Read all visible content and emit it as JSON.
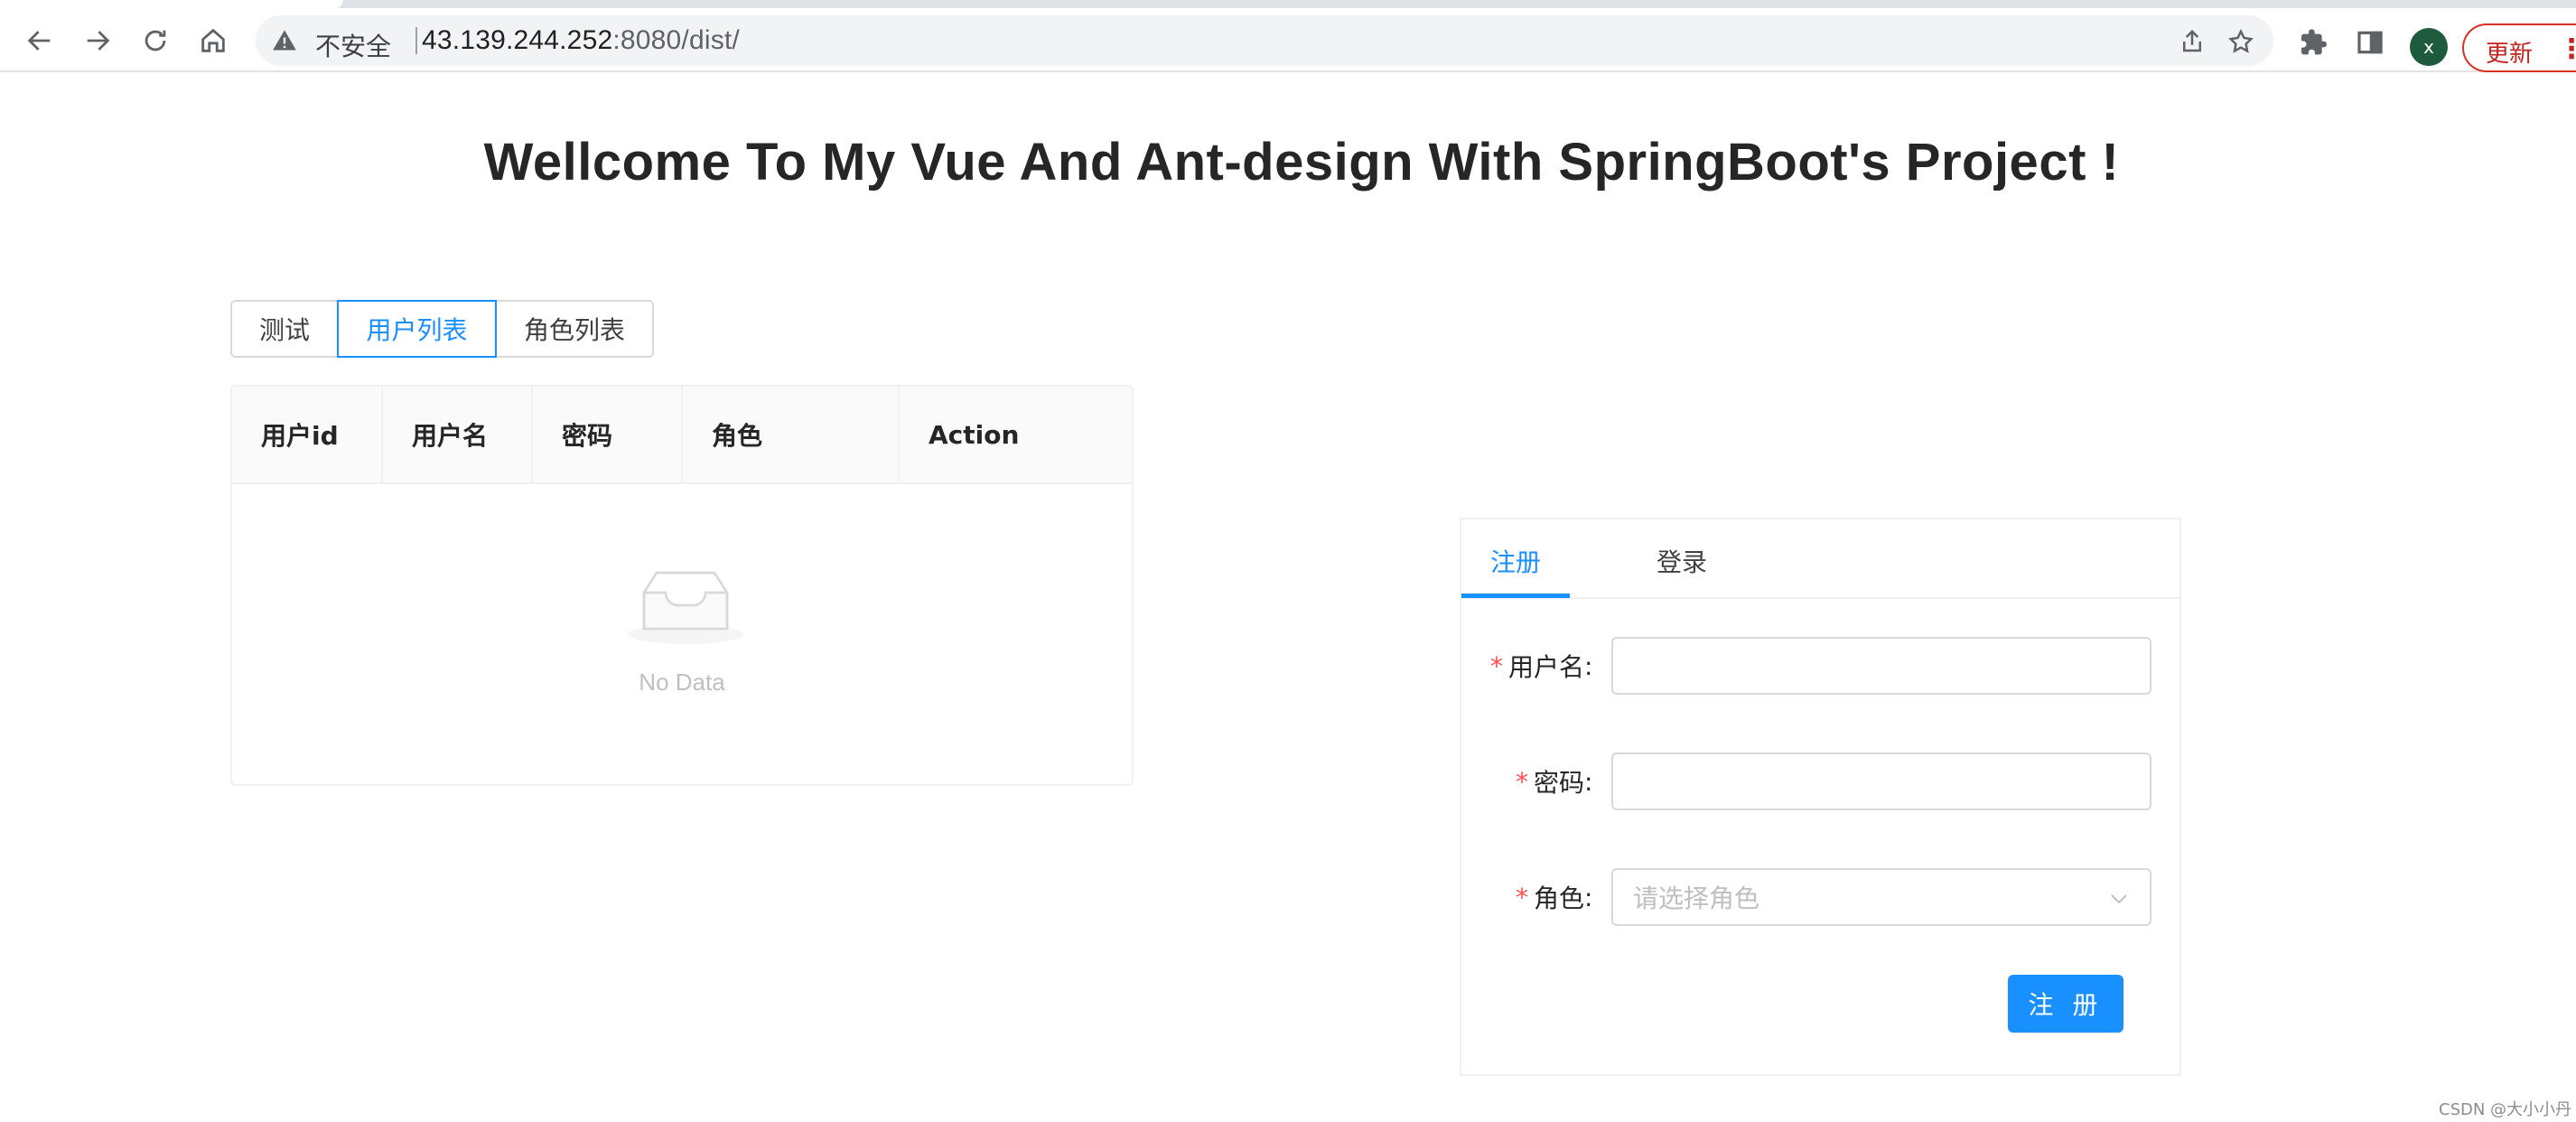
{
  "browser": {
    "security_label": "不安全",
    "url_host": "43.139.244.252",
    "url_path": ":8080/dist/",
    "profile_initial": "x",
    "update_label": "更新",
    "icons": [
      "back-icon",
      "forward-icon",
      "reload-icon",
      "home-icon",
      "warning-icon",
      "share-icon",
      "star-icon",
      "extensions-icon",
      "side-panel-icon",
      "menu-icon"
    ]
  },
  "page": {
    "title": "Wellcome To My Vue And Ant-design With SpringBoot's Project !"
  },
  "list_switch": {
    "options": [
      "测试",
      "用户列表",
      "角色列表"
    ],
    "selected": "用户列表"
  },
  "table": {
    "columns": [
      "用户id",
      "用户名",
      "密码",
      "角色",
      "Action"
    ],
    "rows": [],
    "empty_text": "No Data"
  },
  "auth_card": {
    "tabs": [
      "注册",
      "登录"
    ],
    "active_tab": "注册",
    "fields": {
      "username_label": "用户名",
      "password_label": "密码",
      "role_label": "角色",
      "role_placeholder": "请选择角色",
      "username_value": "",
      "password_value": ""
    },
    "submit_label": "注 册"
  },
  "watermark": "CSDN @大小小丹",
  "colors": {
    "primary": "#1890ff",
    "required": "#ff4d4f",
    "browser_update": "#d93025"
  }
}
